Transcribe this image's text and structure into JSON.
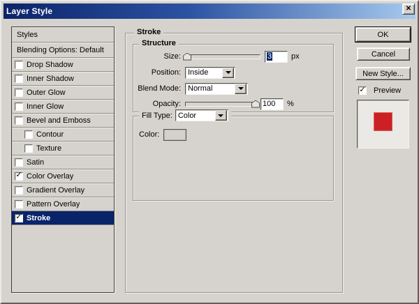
{
  "window": {
    "title": "Layer Style",
    "close_glyph": "✕"
  },
  "glyphs": {
    "check": "✓"
  },
  "styles_panel": {
    "header": "Styles",
    "blending_row": "Blending Options: Default",
    "items": [
      {
        "label": "Drop Shadow",
        "checked": false,
        "selected": false,
        "indent": false
      },
      {
        "label": "Inner Shadow",
        "checked": false,
        "selected": false,
        "indent": false
      },
      {
        "label": "Outer Glow",
        "checked": false,
        "selected": false,
        "indent": false
      },
      {
        "label": "Inner Glow",
        "checked": false,
        "selected": false,
        "indent": false
      },
      {
        "label": "Bevel and Emboss",
        "checked": false,
        "selected": false,
        "indent": false
      },
      {
        "label": "Contour",
        "checked": false,
        "selected": false,
        "indent": true
      },
      {
        "label": "Texture",
        "checked": false,
        "selected": false,
        "indent": true
      },
      {
        "label": "Satin",
        "checked": false,
        "selected": false,
        "indent": false
      },
      {
        "label": "Color Overlay",
        "checked": true,
        "selected": false,
        "indent": false
      },
      {
        "label": "Gradient Overlay",
        "checked": false,
        "selected": false,
        "indent": false
      },
      {
        "label": "Pattern Overlay",
        "checked": false,
        "selected": false,
        "indent": false
      },
      {
        "label": "Stroke",
        "checked": true,
        "selected": true,
        "indent": false
      }
    ]
  },
  "main": {
    "group_title": "Stroke",
    "structure": {
      "title": "Structure",
      "size_label": "Size:",
      "size_value": "3",
      "size_unit": "px",
      "size_percent": 2,
      "position_label": "Position:",
      "position_value": "Inside",
      "blend_label": "Blend Mode:",
      "blend_value": "Normal",
      "opacity_label": "Opacity:",
      "opacity_value": "100",
      "opacity_unit": "%",
      "opacity_percent": 100
    },
    "fill": {
      "type_label": "Fill Type:",
      "type_value": "Color",
      "color_label": "Color:"
    }
  },
  "actions": {
    "ok": "OK",
    "cancel": "Cancel",
    "new_style": "New Style...",
    "preview": "Preview",
    "preview_checked": true
  },
  "colors": {
    "dialog_bg": "#d6d3ce",
    "selection": "#0a246a",
    "titlebar_left": "#0b246a",
    "titlebar_right": "#a7caee",
    "preview_red": "#cb2125",
    "swatch_gray": "#d3d1cb"
  }
}
